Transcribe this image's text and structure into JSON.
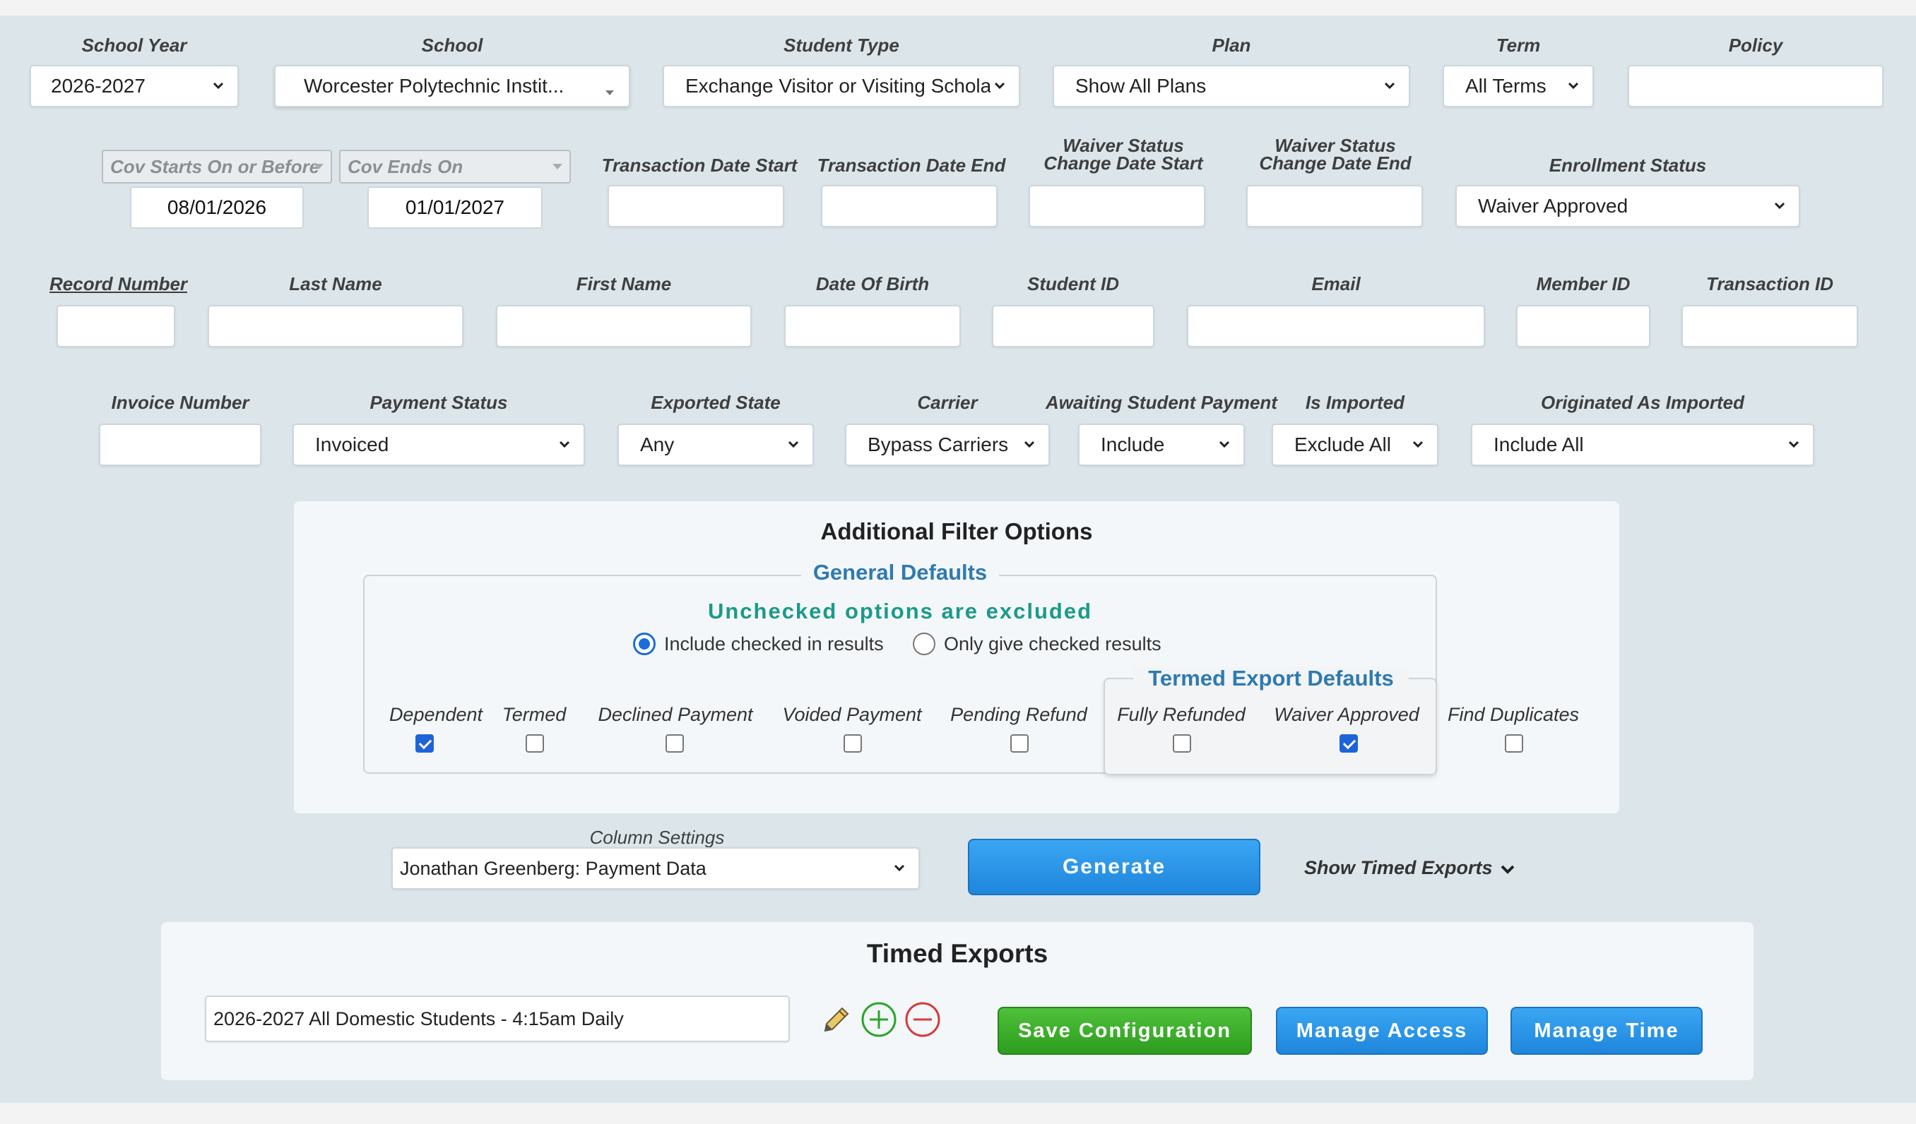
{
  "filters": {
    "school_year": {
      "label": "School Year",
      "value": "2026-2027"
    },
    "school": {
      "label": "School",
      "value": "Worcester Polytechnic Instit..."
    },
    "student_type": {
      "label": "Student Type",
      "value": "Exchange Visitor or Visiting Scholar"
    },
    "plan": {
      "label": "Plan",
      "value": "Show All Plans"
    },
    "term": {
      "label": "Term",
      "value": "All Terms"
    },
    "policy": {
      "label": "Policy",
      "value": ""
    },
    "cov_start": {
      "select_label": "Cov Starts On or Before",
      "value": "08/01/2026"
    },
    "cov_end": {
      "select_label": "Cov Ends On",
      "value": "01/01/2027"
    },
    "transaction_date_start": {
      "label": "Transaction Date Start"
    },
    "transaction_date_end": {
      "label": "Transaction Date End"
    },
    "waiver_status_change_start": {
      "label_line1": "Waiver Status",
      "label_line2": "Change Date Start"
    },
    "waiver_status_change_end": {
      "label_line1": "Waiver Status",
      "label_line2": "Change Date End"
    },
    "enrollment_status": {
      "label": "Enrollment Status",
      "value": "Waiver Approved"
    },
    "record_number": {
      "label": "Record Number"
    },
    "last_name": {
      "label": "Last Name"
    },
    "first_name": {
      "label": "First Name"
    },
    "date_of_birth": {
      "label": "Date Of Birth"
    },
    "student_id": {
      "label": "Student ID"
    },
    "email": {
      "label": "Email"
    },
    "member_id": {
      "label": "Member ID"
    },
    "transaction_id": {
      "label": "Transaction ID"
    },
    "invoice_number": {
      "label": "Invoice Number"
    },
    "payment_status": {
      "label": "Payment Status",
      "value": "Invoiced"
    },
    "exported_state": {
      "label": "Exported State",
      "value": "Any"
    },
    "carrier": {
      "label": "Carrier",
      "value": "Bypass Carriers"
    },
    "awaiting_student_payment": {
      "label": "Awaiting Student Payment",
      "value": "Include"
    },
    "is_imported": {
      "label": "Is Imported",
      "value": "Exclude All"
    },
    "originated_as_imported": {
      "label": "Originated As Imported",
      "value": "Include All"
    }
  },
  "additional": {
    "title": "Additional Filter Options",
    "general_defaults": "General Defaults",
    "unchecked_note": "Unchecked options are excluded",
    "radio_include": "Include checked in results",
    "radio_only": "Only give checked results",
    "termed_export_defaults": "Termed Export Defaults",
    "checkboxes": [
      {
        "label": "Dependent",
        "checked": true
      },
      {
        "label": "Termed",
        "checked": false
      },
      {
        "label": "Declined Payment",
        "checked": false
      },
      {
        "label": "Voided Payment",
        "checked": false
      },
      {
        "label": "Pending Refund",
        "checked": false
      },
      {
        "label": "Fully Refunded",
        "checked": false
      },
      {
        "label": "Waiver Approved",
        "checked": true
      },
      {
        "label": "Find Duplicates",
        "checked": false
      }
    ]
  },
  "column_settings": {
    "label": "Column Settings",
    "value": "Jonathan Greenberg: Payment Data"
  },
  "generate_label": "Generate",
  "show_timed_exports": "Show Timed Exports",
  "timed_exports": {
    "title": "Timed Exports",
    "value": "2026-2027 All Domestic Students - 4:15am Daily",
    "save_label": "Save Configuration",
    "manage_access_label": "Manage Access",
    "manage_time_label": "Manage Time"
  },
  "colors": {
    "accent_blue": "#1f86dc",
    "save_green": "#2e9d1f",
    "teal_note": "#1b9a8a",
    "legend_blue": "#2f7ab0"
  }
}
